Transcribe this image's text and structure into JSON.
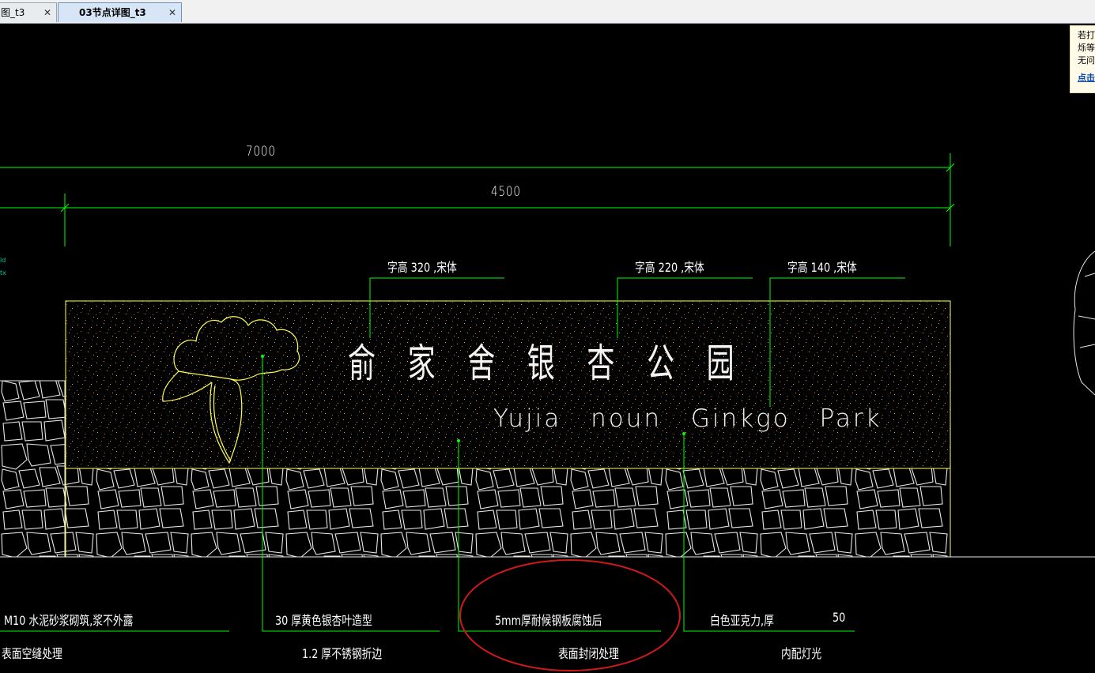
{
  "tabs": [
    {
      "label": "图_t3",
      "active": false
    },
    {
      "label": "03节点详图_t3",
      "active": true
    }
  ],
  "tab_close_glyph": "✕",
  "notice": {
    "line1": "若打",
    "line2": "烁等",
    "line3": "无问",
    "link": "点击"
  },
  "dimensions": {
    "overall": "7000",
    "inner": "4500"
  },
  "font_specs": [
    "字高  320 ,宋体",
    "字高  220 ,宋体",
    "字高  140 ,宋体"
  ],
  "sign": {
    "chinese": "俞家舍银杏公园",
    "english": "Yujia  noun  Ginkgo  Park"
  },
  "notes": {
    "mortar_line1": "M10 水泥砂浆砌筑,浆不外露",
    "mortar_line2": "表面空缝处理",
    "leaf_line1": "30 厚黄色银杏叶造型",
    "leaf_line2": "1.2  厚不锈钢折边",
    "steel_line1": "5mm厚耐候钢板腐蚀后",
    "steel_line2": "表面封闭处理",
    "acrylic_line1": "白色亚克力,厚",
    "acrylic_thickness": "50",
    "acrylic_line2": "内配灯光"
  },
  "colors": {
    "background": "#000000",
    "dimension_line": "#00ff00",
    "outline": "#ffff66",
    "speckle": "#ff8c1a",
    "annotation_circle": "#cc1a1a",
    "tab_active": "#d7e6f7"
  }
}
